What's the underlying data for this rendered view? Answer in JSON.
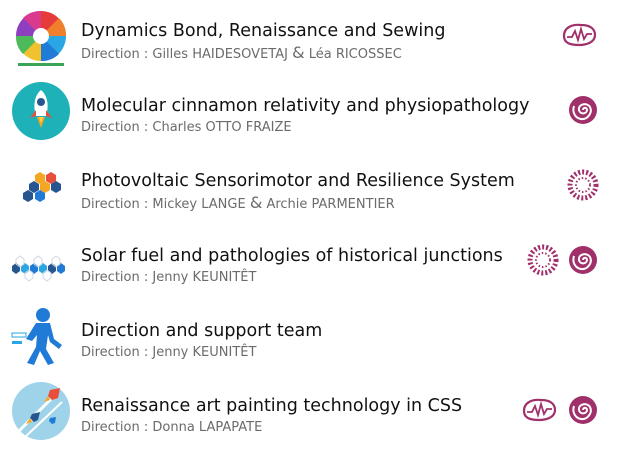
{
  "teams": [
    {
      "title": "Dynamics Bond, Renaissance and Sewing",
      "direction_prefix": "Direction : ",
      "directors": [
        "Gilles HAIDESOVETAJ",
        "Léa RICOSSEC"
      ],
      "separator": "&",
      "logo_icon": "colorful-swirl-logo",
      "badges": [
        "brainwave-icon"
      ]
    },
    {
      "title": "Molecular cinnamon relativity and physiopathology",
      "direction_prefix": "Direction : ",
      "directors": [
        "Charles OTTO FRAIZE"
      ],
      "logo_icon": "rocket-logo",
      "badges": [
        "spiral-icon"
      ]
    },
    {
      "title": "Photovoltaic Sensorimotor and Resilience System",
      "direction_prefix": "Direction : ",
      "directors": [
        "Mickey LANGE",
        "Archie PARMENTIER"
      ],
      "separator": "&",
      "logo_icon": "hexagons-logo",
      "badges": [
        "cell-ring-icon"
      ]
    },
    {
      "title": "Solar fuel and pathologies of historical junctions",
      "direction_prefix": "Direction : ",
      "directors": [
        "Jenny KEUNITÊT"
      ],
      "logo_icon": "hexagon-chain-logo",
      "badges": [
        "cell-ring-icon",
        "spiral-icon"
      ]
    },
    {
      "title": "Direction and support team",
      "direction_prefix": "Direction : ",
      "directors": [
        "Jenny KEUNITÊT"
      ],
      "logo_icon": "walking-person-logo",
      "badges": []
    },
    {
      "title": "Renaissance art painting technology in CSS",
      "direction_prefix": "Direction : ",
      "directors": [
        "Donna LAPAPATE"
      ],
      "logo_icon": "rockets-launch-logo",
      "badges": [
        "brainwave-icon",
        "spiral-icon"
      ]
    }
  ],
  "colors": {
    "badge": "#a0306a",
    "title": "#111111",
    "direction": "#6b6b6b"
  }
}
